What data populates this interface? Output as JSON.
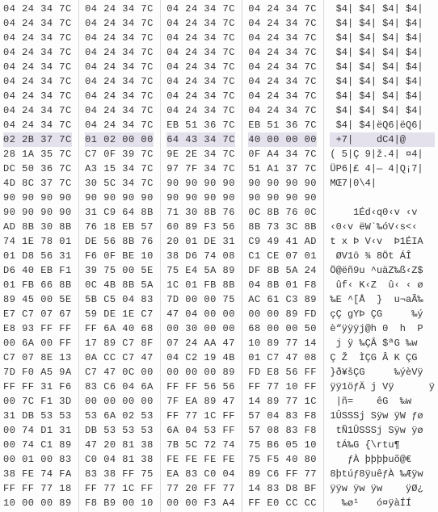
{
  "hex": {
    "selected_row": 9,
    "rows": [
      {
        "b": [
          "04 24 34 7C",
          "04 24 34 7C",
          "04 24 34 7C",
          "04 24 34 7C"
        ],
        "a": " $4| $4| $4| $4|"
      },
      {
        "b": [
          "04 24 34 7C",
          "04 24 34 7C",
          "04 24 34 7C",
          "04 24 34 7C"
        ],
        "a": " $4| $4| $4| $4|"
      },
      {
        "b": [
          "04 24 34 7C",
          "04 24 34 7C",
          "04 24 34 7C",
          "04 24 34 7C"
        ],
        "a": " $4| $4| $4| $4|"
      },
      {
        "b": [
          "04 24 34 7C",
          "04 24 34 7C",
          "04 24 34 7C",
          "04 24 34 7C"
        ],
        "a": " $4| $4| $4| $4|"
      },
      {
        "b": [
          "04 24 34 7C",
          "04 24 34 7C",
          "04 24 34 7C",
          "04 24 34 7C"
        ],
        "a": " $4| $4| $4| $4|"
      },
      {
        "b": [
          "04 24 34 7C",
          "04 24 34 7C",
          "04 24 34 7C",
          "04 24 34 7C"
        ],
        "a": " $4| $4| $4| $4|"
      },
      {
        "b": [
          "04 24 34 7C",
          "04 24 34 7C",
          "04 24 34 7C",
          "04 24 34 7C"
        ],
        "a": " $4| $4| $4| $4|"
      },
      {
        "b": [
          "04 24 34 7C",
          "04 24 34 7C",
          "04 24 34 7C",
          "04 24 34 7C"
        ],
        "a": " $4| $4| $4| $4|"
      },
      {
        "b": [
          "04 24 34 7C",
          "04 24 34 7C",
          "EB 51 36 7C",
          "EB 51 36 7C"
        ],
        "a": " $4| $4|ëQ6|ëQ6|"
      },
      {
        "b": [
          "02 2B 37 7C",
          "01 02 00 00",
          "64 43 34 7C",
          "40 00 00 00"
        ],
        "a": " +7|    dC4|@   "
      },
      {
        "b": [
          "28 1A 35 7C",
          "C7 0F 39 7C",
          "9E 2E 34 7C",
          "0F A4 34 7C"
        ],
        "a": "( 5|Ç 9|ž.4| ¤4|"
      },
      {
        "b": [
          "DC 50 36 7C",
          "A3 15 34 7C",
          "97 7F 34 7C",
          "51 A1 37 7C"
        ],
        "a": "ÜP6|£ 4|— 4|Q¡7|"
      },
      {
        "b": [
          "4D 8C 37 7C",
          "30 5C 34 7C",
          "90 90 90 90",
          "90 90 90 90"
        ],
        "a": "MŒ7|0\\4|        "
      },
      {
        "b": [
          "90 90 90 90",
          "90 90 90 90",
          "90 90 90 90",
          "90 90 90 90"
        ],
        "a": "                "
      },
      {
        "b": [
          "90 90 90 90",
          "31 C9 64 8B",
          "71 30 8B 76",
          "0C 8B 76 0C"
        ],
        "a": "    1Éd‹q0‹v ‹v "
      },
      {
        "b": [
          "AD 8B 30 8B",
          "76 18 EB 57",
          "60 89 F3 56",
          "8B 73 3C 8B"
        ],
        "a": "­‹0‹v ëW`‰óV‹s<‹"
      },
      {
        "b": [
          "74 1E 78 01",
          "DE 56 8B 76",
          "20 01 DE 31",
          "C9 49 41 AD"
        ],
        "a": "t x Þ V‹v  Þ1ÉIA­"
      },
      {
        "b": [
          "01 D8 56 31",
          "F6 0F BE 10",
          "38 D6 74 08",
          "C1 CE 07 01"
        ],
        "a": " ØV1ö ¾ 8Öt ÁÎ  "
      },
      {
        "b": [
          "D6 40 EB F1",
          "39 75 00 5E",
          "75 E4 5A 89",
          "DF 8B 5A 24"
        ],
        "a": "Ö@ëñ9u ^uäZ‰ß‹Z$"
      },
      {
        "b": [
          "01 FB 66 8B",
          "0C 4B 8B 5A",
          "1C 01 FB 8B",
          "04 8B 01 F8"
        ],
        "a": " ûf‹ K‹Z  û‹ ‹ ø"
      },
      {
        "b": [
          "89 45 00 5E",
          "5B C5 04 83",
          "7D 00 00 75",
          "AC 61 C3 89"
        ],
        "a": "‰E ^[Å  }  u¬aÃ‰"
      },
      {
        "b": [
          "E7 C7 07 67",
          "59 DE 1E C7",
          "47 04 00 00",
          "00 00 89 FD"
        ],
        "a": "çÇ gYÞ ÇG     ‰ý"
      },
      {
        "b": [
          "E8 93 FF FF",
          "FF 6A 40 68",
          "00 30 00 00",
          "68 00 00 50"
        ],
        "a": "è“ÿÿÿj@h 0  h  P"
      },
      {
        "b": [
          "00 6A 00 FF",
          "17 89 C7 8F",
          "07 24 AA 47",
          "10 89 77 14"
        ],
        "a": " j ÿ ‰ÇÂ $ªG ‰w "
      },
      {
        "b": [
          "C7 07 8E 13",
          "0A CC C7 47",
          "04 C2 19 4B",
          "01 C7 47 08"
        ],
        "a": "Ç Ž  ÌÇG Â K ÇG "
      },
      {
        "b": [
          "7D F0 A5 9A",
          "C7 47 0C 00",
          "00 00 00 89",
          "FD E8 56 FF"
        ],
        "a": "}ð¥šÇG     ‰ýèVÿ"
      },
      {
        "b": [
          "FF FF 31 F6",
          "83 C6 04 6A",
          "FF FF 56 56",
          "FF 77 10 FF"
        ],
        "a": "ÿÿ1öƒÄ j Vÿ      ÿ"
      },
      {
        "b": [
          "00 7C F1 3D",
          "00 00 00 00",
          "7F EA 89 47",
          "14 89 77 1C"
        ],
        "a": " |ñ=    êG  ‰w  "
      },
      {
        "b": [
          "31 DB 53 53",
          "53 6A 02 53",
          "FF 77 1C FF",
          "57 04 83 F8"
        ],
        "a": "1ÛSSSj Sÿw ÿW ƒø"
      },
      {
        "b": [
          "00 74 D1 31",
          "DB 53 53 53",
          "6A 04 53 FF",
          "57 08 83 F8"
        ],
        "a": " tÑ1ÛSSSj Sÿw ÿø"
      },
      {
        "b": [
          "00 74 C1 89",
          "47 20 81 38",
          "7B 5C 72 74",
          "75 B6 05 10"
        ],
        "a": " tÁ‰G {\\rtu¶   "
      },
      {
        "b": [
          "00 01 00 83",
          "C0 04 81 38",
          "FE FE FE FE",
          "75 F5 40 80"
        ],
        "a": "   ƒÀ þþþþuõ@€  "
      },
      {
        "b": [
          "38 FE 74 FA",
          "83 38 FF 75",
          "EA 83 C0 04",
          "89 C6 FF 77"
        ],
        "a": "8þtúƒ8ÿuêƒÀ ‰Æÿw"
      },
      {
        "b": [
          "FF FF 77 18",
          "FF 77 1C FF",
          "77 20 FF 77",
          "14 83 D8 BF"
        ],
        "a": "ÿÿw ÿw ÿw    ÿØ¿"
      },
      {
        "b": [
          "10 00 00 89",
          "F8 B9 00 10",
          "00 00 F3 A4",
          "FF E0 CC CC"
        ],
        "a": "  ‰ø¹   ó¤ÿàÍÍ  "
      }
    ]
  }
}
